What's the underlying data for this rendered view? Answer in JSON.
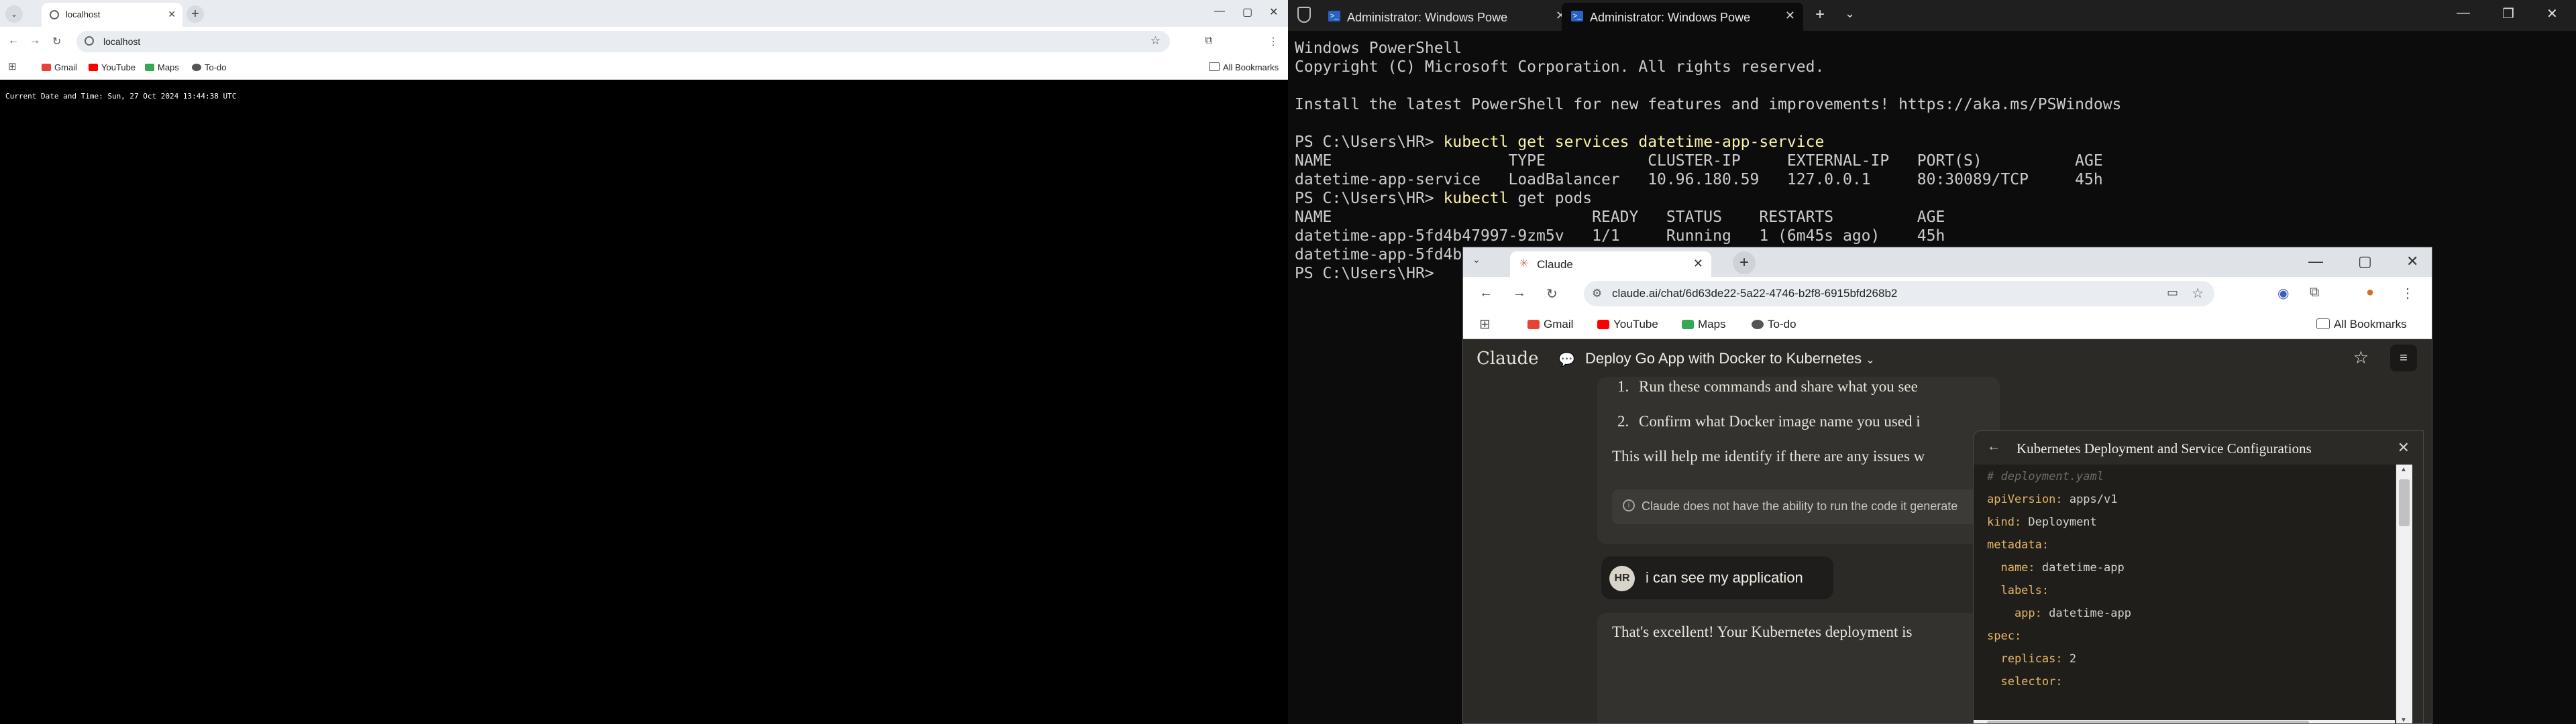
{
  "left_browser": {
    "tab_title": "localhost",
    "url": "localhost",
    "bookmarks": [
      "Gmail",
      "YouTube",
      "Maps",
      "To-do"
    ],
    "all_bookmarks": "All Bookmarks",
    "page_text": "Current Date and Time: Sun, 27 Oct 2024 13:44:38 UTC"
  },
  "powershell": {
    "tabs": [
      "Administrator: Windows Powe",
      "Administrator: Windows Powe"
    ],
    "lines": {
      "l1": "Windows PowerShell",
      "l2": "Copyright (C) Microsoft Corporation. All rights reserved.",
      "l3": "Install the latest PowerShell for new features and improvements! https://aka.ms/PSWindows",
      "p1": "PS C:\\Users\\HR> ",
      "c1": "kubectl get services datetime-app-service",
      "h1": "NAME                   TYPE           CLUSTER-IP     EXTERNAL-IP   PORT(S)          AGE",
      "r1": "datetime-app-service   LoadBalancer   10.96.180.59   127.0.0.1     80:30089/TCP     45h",
      "p2": "PS C:\\Users\\HR> ",
      "c2": "kubectl",
      "c2b": " get pods",
      "h2": "NAME                            READY   STATUS    RESTARTS         AGE",
      "r2": "datetime-app-5fd4b47997-9zm5v   1/1     Running   1 (6m45s ago)    45h",
      "r3": "datetime-app-5fd4b",
      "p3": "PS C:\\Users\\HR>"
    }
  },
  "claude_browser": {
    "tab_title": "Claude",
    "url": "claude.ai/chat/6d63de22-5a22-4746-b2f8-6915bfd268b2",
    "bookmarks": [
      "Gmail",
      "YouTube",
      "Maps",
      "To-do"
    ],
    "all_bookmarks": "All Bookmarks",
    "logo": "Claude",
    "chat_title": "Deploy Go App with Docker to Kubernetes",
    "list_items": [
      "Run these commands and share what you see",
      "Confirm what Docker image name you used i"
    ],
    "list_numbers": [
      "1.",
      "2."
    ],
    "para1": "This will help me identify if there are any issues w",
    "note": "Claude does not have the ability to run the code it generate",
    "user_initials": "HR",
    "user_message": "i can see my application",
    "reply": "That's excellent! Your Kubernetes deployment is",
    "artifact": {
      "title": "Kubernetes Deployment and Service Configurations",
      "code": [
        {
          "k": "# deployment.yaml",
          "v": ""
        },
        {
          "k": "apiVersion:",
          "v": " apps/v1"
        },
        {
          "k": "kind:",
          "v": " Deployment"
        },
        {
          "k": "metadata:",
          "v": ""
        },
        {
          "k": "  name:",
          "v": " datetime-app"
        },
        {
          "k": "  labels:",
          "v": ""
        },
        {
          "k": "    app:",
          "v": " datetime-app"
        },
        {
          "k": "spec:",
          "v": ""
        },
        {
          "k": "  replicas:",
          "v": " 2"
        },
        {
          "k": "  selector:",
          "v": ""
        }
      ]
    }
  },
  "colors": {
    "terminal_bg": "#0c0c0c",
    "terminal_text": "#cccccc",
    "command_yellow": "#f9f1a5",
    "claude_bg": "#2b2a27",
    "claude_accent": "#d97757",
    "code_key": "#e5b567"
  }
}
